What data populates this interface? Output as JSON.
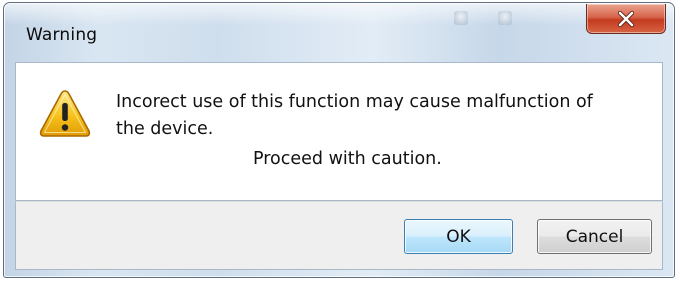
{
  "window": {
    "title": "Warning",
    "close_icon": "close-icon",
    "accent_close": "#c43b1f"
  },
  "message": {
    "icon": "warning-icon",
    "line1": "Incorect use of this function may cause malfunction of",
    "line2": "the device.",
    "line3": "Proceed with caution."
  },
  "buttons": {
    "ok_label": "OK",
    "cancel_label": "Cancel",
    "ok_border": "#3c7fb1"
  }
}
